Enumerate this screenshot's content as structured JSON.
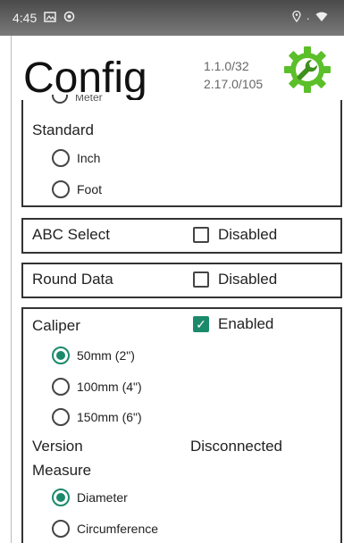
{
  "status_bar": {
    "time": "4:45",
    "left_icons": [
      "image-icon",
      "circle-icon"
    ],
    "right_icons": [
      "location-icon",
      "wifi-icon"
    ]
  },
  "header": {
    "title": "Config",
    "version_line1": "1.1.0/32",
    "version_line2": "2.17.0/105",
    "settings_icon": "gear-wrench-icon",
    "accent_color": "#5bbf2a"
  },
  "units": {
    "partial_option": "Meter",
    "standard_label": "Standard",
    "options": [
      {
        "label": "Inch",
        "selected": false
      },
      {
        "label": "Foot",
        "selected": false
      }
    ]
  },
  "abc_select": {
    "label": "ABC Select",
    "checkbox_label": "Disabled",
    "checked": false
  },
  "round_data": {
    "label": "Round Data",
    "checkbox_label": "Disabled",
    "checked": false
  },
  "caliper": {
    "label": "Caliper",
    "checkbox_label": "Enabled",
    "checked": true,
    "sizes": [
      {
        "label": "50mm (2\")",
        "selected": true
      },
      {
        "label": "100mm (4\")",
        "selected": false
      },
      {
        "label": "150mm (6\")",
        "selected": false
      }
    ],
    "version_label": "Version",
    "version_value": "Disconnected",
    "measure_label": "Measure",
    "measure_options": [
      {
        "label": "Diameter",
        "selected": true
      },
      {
        "label": "Circumference",
        "selected": false
      }
    ]
  },
  "colors": {
    "accent": "#1b8a6b",
    "border": "#333333"
  }
}
